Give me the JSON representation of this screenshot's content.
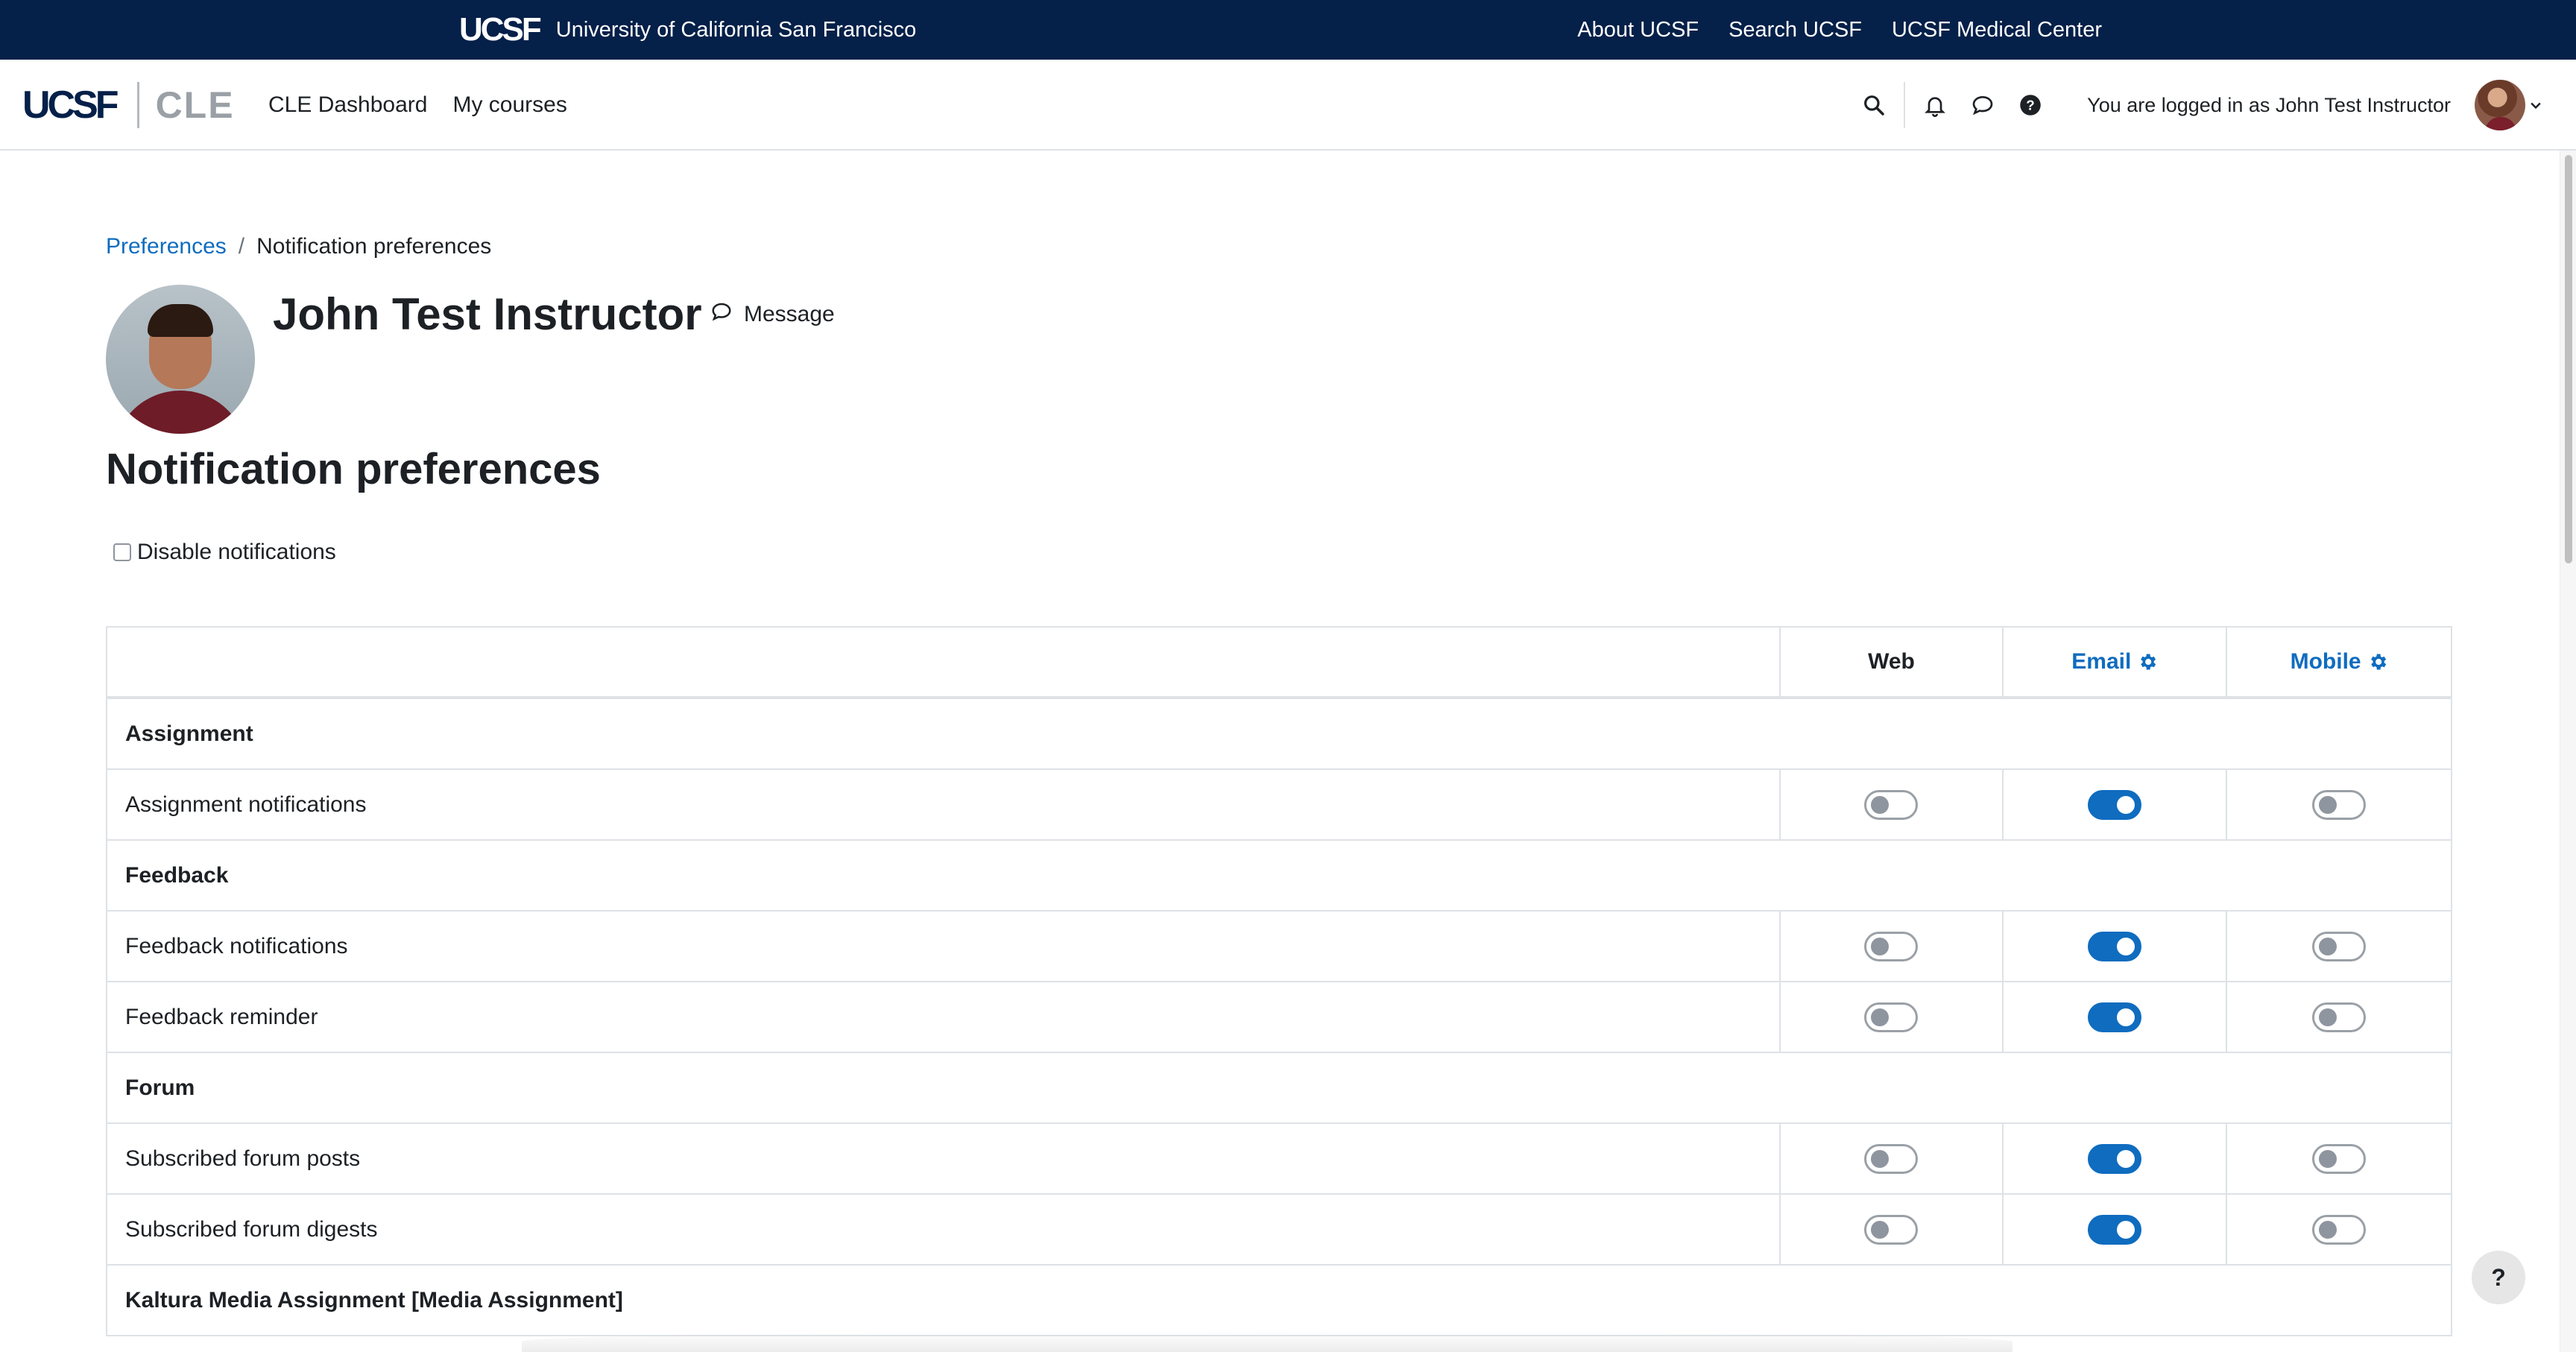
{
  "topbar": {
    "brand_mark": "UCSF",
    "university": "University of California San Francisco",
    "links": [
      "About UCSF",
      "Search UCSF",
      "UCSF Medical Center"
    ]
  },
  "navbar": {
    "logo_text": "UCSF",
    "logo_sub": "CLE",
    "nav": [
      "CLE Dashboard",
      "My courses"
    ],
    "logged_in_text": "You are logged in as John Test Instructor",
    "icons": [
      "search-icon",
      "bell-icon",
      "chat-icon",
      "help-icon",
      "chevron-down-icon"
    ]
  },
  "breadcrumb": {
    "parent": "Preferences",
    "separator": "/",
    "current": "Notification preferences"
  },
  "profile": {
    "name": "John Test Instructor",
    "message_label": "Message"
  },
  "page_title": "Notification preferences",
  "disable_notifications": {
    "label": "Disable notifications",
    "checked": false
  },
  "table": {
    "columns": [
      "Web",
      "Email",
      "Mobile"
    ],
    "sections": [
      {
        "title": "Assignment",
        "rows": [
          {
            "label": "Assignment notifications",
            "web": false,
            "email": true,
            "mobile": false
          }
        ]
      },
      {
        "title": "Feedback",
        "rows": [
          {
            "label": "Feedback notifications",
            "web": false,
            "email": true,
            "mobile": false
          },
          {
            "label": "Feedback reminder",
            "web": false,
            "email": true,
            "mobile": false
          }
        ]
      },
      {
        "title": "Forum",
        "rows": [
          {
            "label": "Subscribed forum posts",
            "web": false,
            "email": true,
            "mobile": false
          },
          {
            "label": "Subscribed forum digests",
            "web": false,
            "email": true,
            "mobile": false
          }
        ]
      },
      {
        "title": "Kaltura Media Assignment [Media Assignment]",
        "rows": []
      }
    ]
  },
  "help_button": "?",
  "colors": {
    "topbar": "#052049",
    "accent": "#0f6cbf",
    "text": "#1d2125"
  }
}
